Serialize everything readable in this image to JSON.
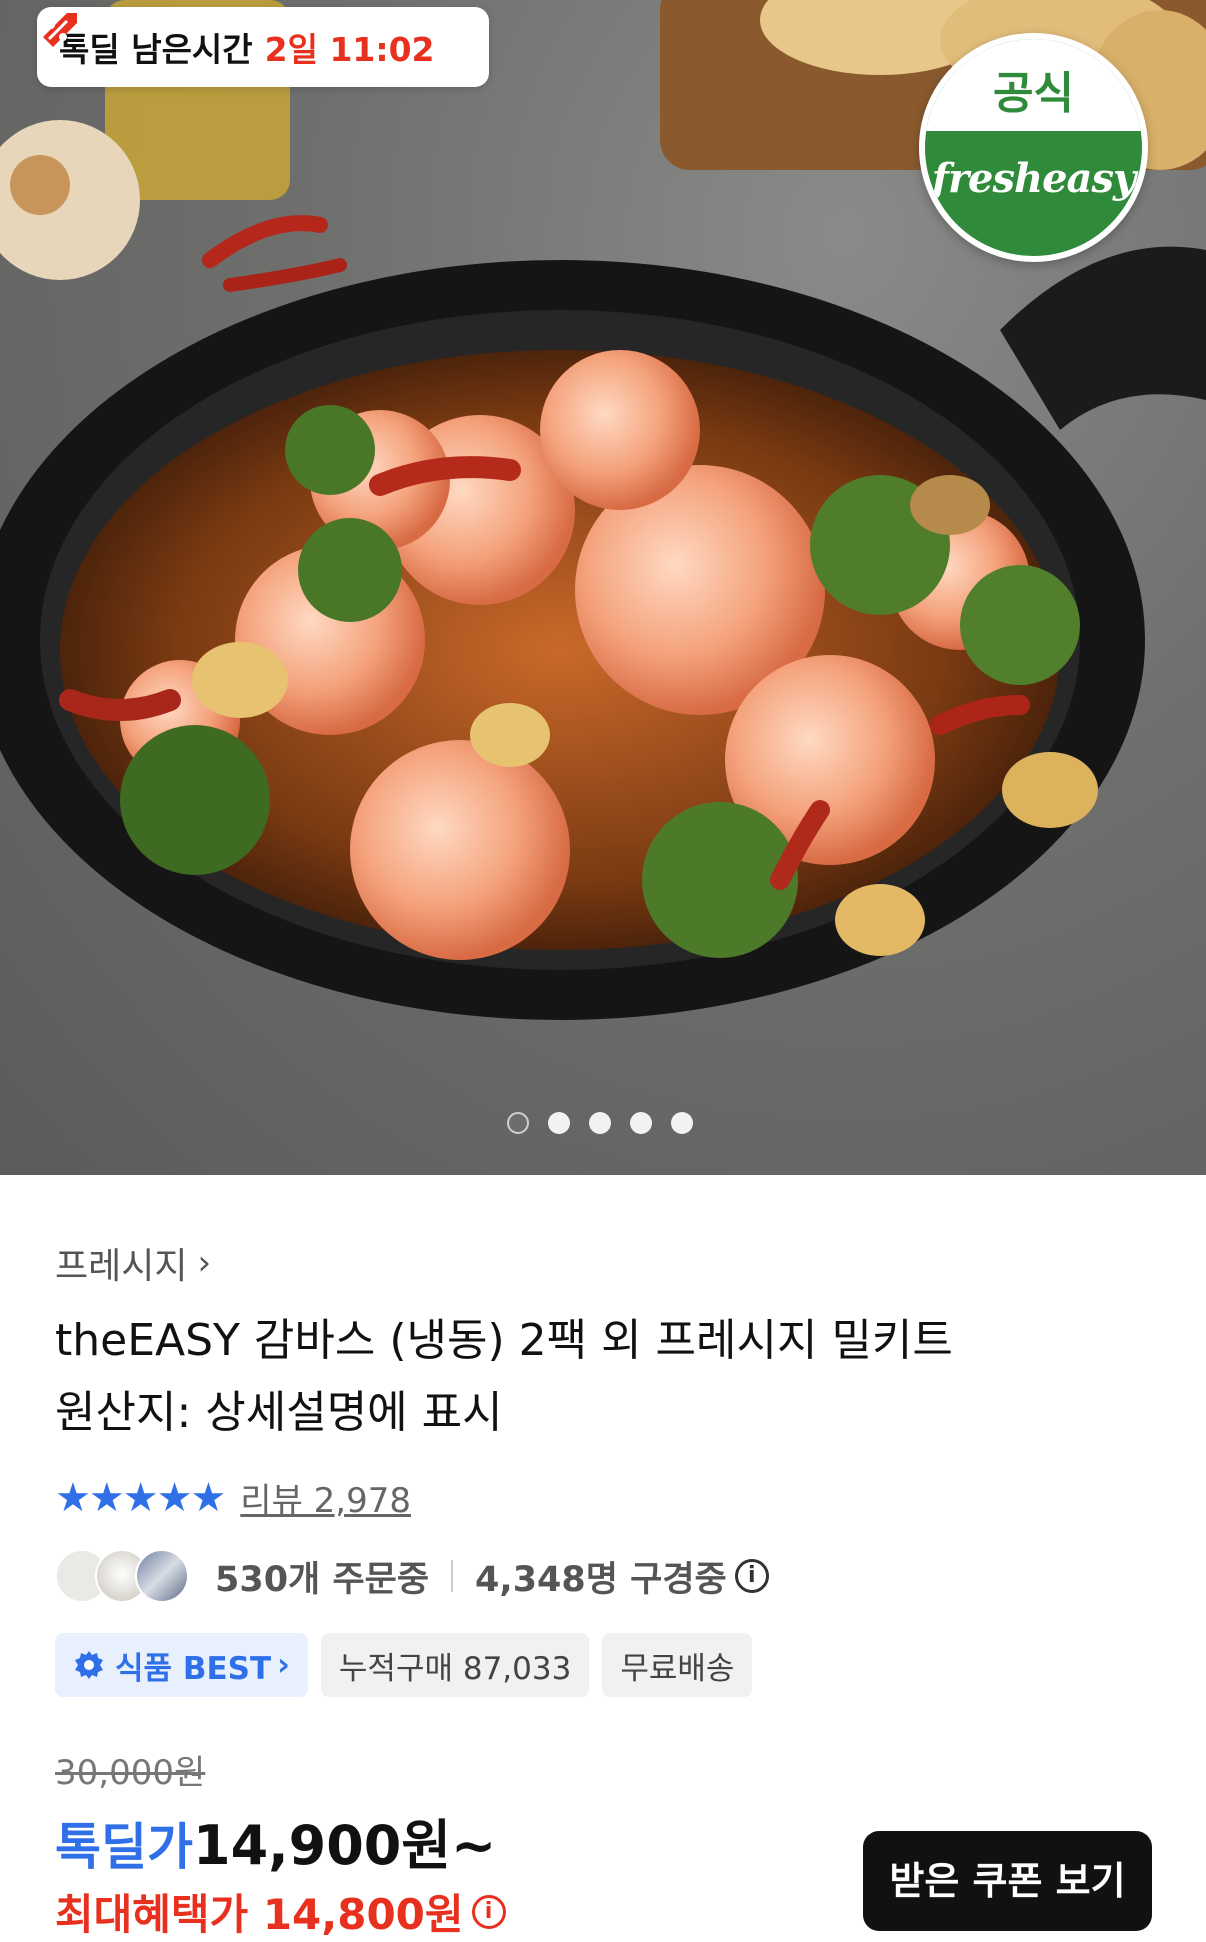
{
  "timer": {
    "label": "톡딜 남은시간",
    "value": "2일 11:02"
  },
  "badge": {
    "top": "공식",
    "bottom": "fresheasy"
  },
  "carousel": {
    "count": 5,
    "active": 0
  },
  "product": {
    "brand": "프레시지",
    "title_line1": "theEASY 감바스 (냉동) 2팩 외 프레시지 밀키트",
    "title_line2": "원산지: 상세설명에 표시",
    "stars": "★★★★★",
    "review_text": "리뷰 2,978",
    "ordering": "530개 주문중",
    "watching": "4,348명 구경중",
    "chips": {
      "best": "식품 BEST",
      "cumulative": "누적구매 87,033",
      "shipping": "무료배송"
    },
    "original_price": "30,000원",
    "price_label": "톡딜가",
    "price": "14,900원~",
    "max_benefit": "최대혜택가 14,800원",
    "coupon_button": "받은 쿠폰 보기"
  },
  "colors": {
    "accent_blue": "#2f6fe8",
    "accent_red": "#e8301e",
    "badge_green": "#2f8a3a"
  },
  "icons": [
    "percent-tag-icon",
    "chevron-right-icon",
    "star-icon",
    "info-icon",
    "gear-badge-icon"
  ]
}
